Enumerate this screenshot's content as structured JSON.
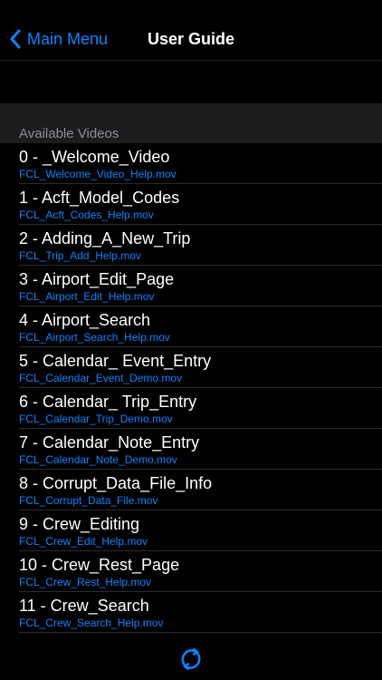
{
  "navbar": {
    "back_label": "Main Menu",
    "title": "User Guide"
  },
  "section": {
    "header": "Available Videos"
  },
  "videos": [
    {
      "title": "0 - _Welcome_Video",
      "file": "FCL_Welcome_Video_Help.mov"
    },
    {
      "title": "1 - Acft_Model_Codes",
      "file": "FCL_Acft_Codes_Help.mov"
    },
    {
      "title": "2 - Adding_A_New_Trip",
      "file": "FCL_Trip_Add_Help.mov"
    },
    {
      "title": "3 - Airport_Edit_Page",
      "file": "FCL_Airport_Edit_Help.mov"
    },
    {
      "title": "4 - Airport_Search",
      "file": "FCL_Airport_Search_Help.mov"
    },
    {
      "title": "5 - Calendar_ Event_Entry",
      "file": "FCL_Calendar_Event_Demo.mov"
    },
    {
      "title": "6 - Calendar_ Trip_Entry",
      "file": "FCL_Calendar_Trip_Demo.mov"
    },
    {
      "title": "7 - Calendar_Note_Entry",
      "file": "FCL_Calendar_Note_Demo.mov"
    },
    {
      "title": "8 - Corrupt_Data_File_Info",
      "file": "FCL_Corrupt_Data_File.mov"
    },
    {
      "title": "9 - Crew_Editing",
      "file": "FCL_Crew_Edit_Help.mov"
    },
    {
      "title": "10 - Crew_Rest_Page",
      "file": "FCL_Crew_Rest_Help.mov"
    },
    {
      "title": "11 - Crew_Search",
      "file": "FCL_Crew_Search_Help.mov"
    }
  ],
  "icons": {
    "back": "chevron-left-icon",
    "refresh": "refresh-icon"
  },
  "colors": {
    "accent": "#0a84ff",
    "background": "#000000",
    "section_header_bg": "#1c1c1e",
    "section_header_text": "#8e8e93"
  }
}
